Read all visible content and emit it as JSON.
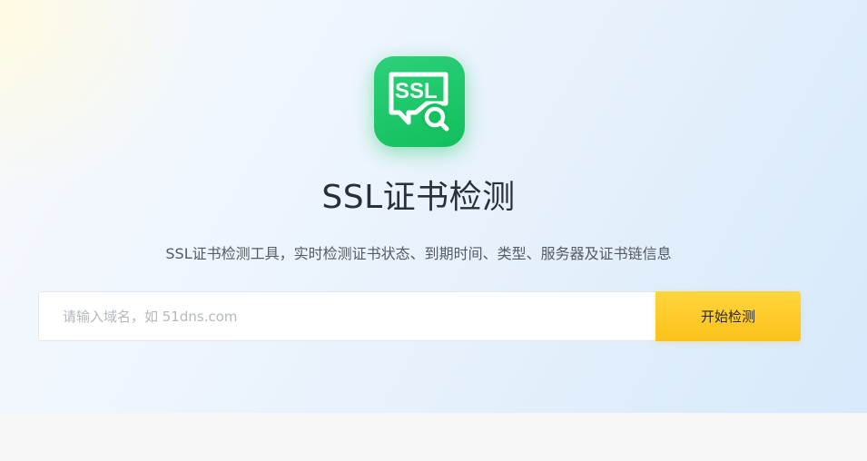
{
  "logo": {
    "icon": "ssl-search-icon",
    "text": "SSL",
    "color": "#1ac667"
  },
  "header": {
    "title": "SSL证书检测",
    "subtitle": "SSL证书检测工具，实时检测证书状态、到期时间、类型、服务器及证书链信息"
  },
  "search": {
    "value": "",
    "placeholder": "请输入域名，如 51dns.com",
    "button_label": "开始检测",
    "button_color": "#fcc21b"
  }
}
